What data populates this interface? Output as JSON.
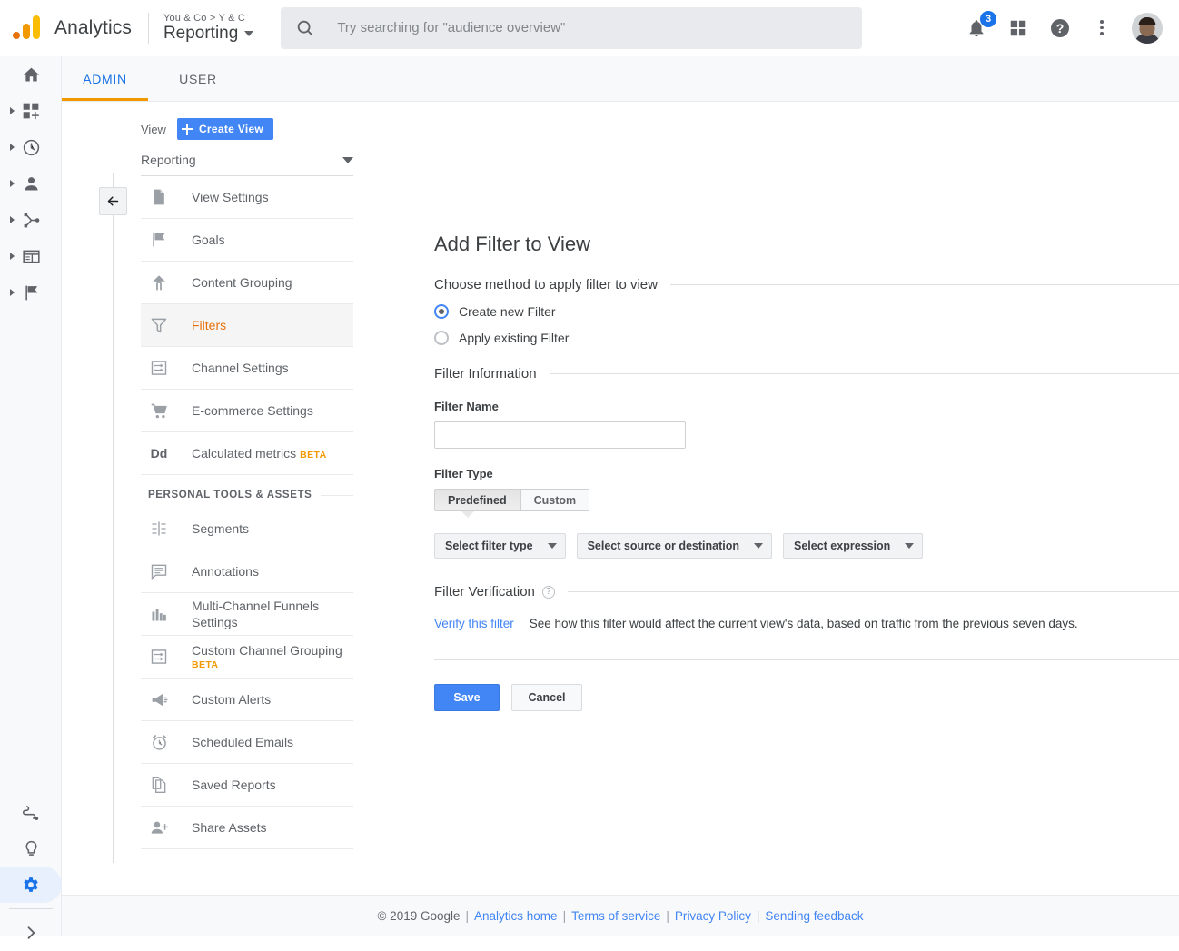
{
  "topbar": {
    "logo_icon": "analytics-logo-icon",
    "brand": "Analytics",
    "account_breadcrumb": "You & Co > Y & C",
    "property_name": "Reporting",
    "search": {
      "icon": "search-icon",
      "placeholder": "Try searching for \"audience overview\"",
      "value": ""
    },
    "notifications": {
      "icon": "bell-icon",
      "count": "3"
    },
    "apps_icon": "apps-grid-icon",
    "help_icon": "help-circle-icon",
    "more_icon": "kebab-more-icon",
    "avatar_icon": "user-avatar"
  },
  "rail": {
    "items": [
      {
        "icon": "home-icon",
        "name": "home",
        "expandable": false
      },
      {
        "icon": "customization-icon",
        "name": "customization",
        "expandable": true
      },
      {
        "icon": "realtime-clock-icon",
        "name": "realtime",
        "expandable": true
      },
      {
        "icon": "audience-person-icon",
        "name": "audience",
        "expandable": true
      },
      {
        "icon": "acquisition-share-icon",
        "name": "acquisition",
        "expandable": true
      },
      {
        "icon": "behavior-window-icon",
        "name": "behavior",
        "expandable": true
      },
      {
        "icon": "conversions-flag-icon",
        "name": "conversions",
        "expandable": true
      }
    ],
    "bottom_items": [
      {
        "icon": "attribution-path-icon",
        "name": "attribution"
      },
      {
        "icon": "discover-bulb-icon",
        "name": "discover"
      },
      {
        "icon": "admin-gear-icon",
        "name": "admin",
        "active": true
      },
      {
        "icon": "expand-chevron-icon",
        "name": "expand-rail"
      }
    ]
  },
  "tabs": [
    {
      "label": "ADMIN",
      "active": true
    },
    {
      "label": "USER",
      "active": false
    }
  ],
  "admin_nav": {
    "collapse_icon": "collapse-left-arrow-icon",
    "view_label": "View",
    "create_view_button": "Create View",
    "create_view_icon": "plus-icon",
    "view_selected": "Reporting",
    "view_dropdown_icon": "triangle-down-icon",
    "items": [
      {
        "label": "View Settings",
        "icon": "document-icon",
        "selected": false
      },
      {
        "label": "Goals",
        "icon": "flag-icon",
        "selected": false
      },
      {
        "label": "Content Grouping",
        "icon": "content-grouping-icon",
        "selected": false
      },
      {
        "label": "Filters",
        "icon": "funnel-filter-icon",
        "selected": true
      },
      {
        "label": "Channel Settings",
        "icon": "channel-settings-icon",
        "selected": false
      },
      {
        "label": "E-commerce Settings",
        "icon": "shopping-cart-icon",
        "selected": false
      },
      {
        "label": "Calculated metrics",
        "icon": "dd-text-icon",
        "badge": "BETA",
        "selected": false
      }
    ],
    "section_title": "PERSONAL TOOLS & ASSETS",
    "personal_items": [
      {
        "label": "Segments",
        "icon": "segments-icon"
      },
      {
        "label": "Annotations",
        "icon": "annotation-bubble-icon"
      },
      {
        "label": "Multi-Channel Funnels Settings",
        "icon": "bar-chart-icon"
      },
      {
        "label": "Custom Channel Grouping",
        "icon": "channel-settings-icon",
        "badge": "BETA"
      },
      {
        "label": "Custom Alerts",
        "icon": "megaphone-icon"
      },
      {
        "label": "Scheduled Emails",
        "icon": "alarm-clock-icon"
      },
      {
        "label": "Saved Reports",
        "icon": "copy-document-icon"
      },
      {
        "label": "Share Assets",
        "icon": "person-add-icon"
      }
    ]
  },
  "main": {
    "page_title": "Add Filter to View",
    "method_section": "Choose method to apply filter to view",
    "radios": [
      {
        "label": "Create new Filter",
        "selected": true
      },
      {
        "label": "Apply existing Filter",
        "selected": false
      }
    ],
    "filter_info_section": "Filter Information",
    "filter_name_label": "Filter Name",
    "filter_name_value": "",
    "filter_name_placeholder": "",
    "filter_type_label": "Filter Type",
    "filter_type_options": [
      {
        "label": "Predefined",
        "selected": true
      },
      {
        "label": "Custom",
        "selected": false
      }
    ],
    "dropdowns": [
      {
        "label": "Select filter type"
      },
      {
        "label": "Select source or destination"
      },
      {
        "label": "Select expression"
      }
    ],
    "verification_section": "Filter Verification",
    "verification_help_icon": "question-mark-icon",
    "verify_link": "Verify this filter",
    "verify_description": "See how this filter would affect the current view's data, based on traffic from the previous seven days.",
    "save_button": "Save",
    "cancel_button": "Cancel"
  },
  "footer": {
    "copyright": "© 2019 Google",
    "links": [
      "Analytics home",
      "Terms of service",
      "Privacy Policy",
      "Sending feedback"
    ],
    "separator": "|"
  },
  "colors": {
    "blue": "#4285f4",
    "blue_tab": "#1a73e8",
    "orange_underline": "#f29900",
    "selected_nav_text": "#e8710a",
    "beta_orange": "#f29900",
    "rail_bg": "#f8f9fa"
  }
}
